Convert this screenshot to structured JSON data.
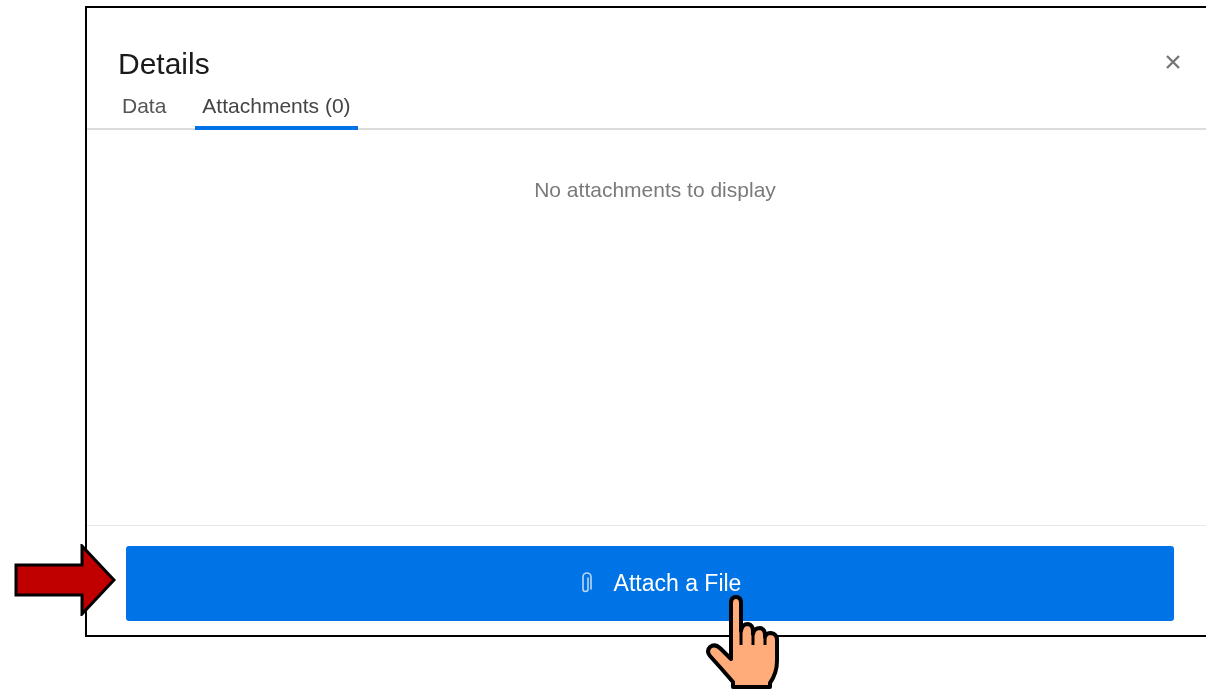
{
  "dialog": {
    "title": "Details",
    "tabs": [
      {
        "label": "Data",
        "selected": false
      },
      {
        "label": "Attachments (0)",
        "selected": true
      }
    ],
    "empty_message": "No attachments to display",
    "attach_button": {
      "label": "Attach a File"
    }
  }
}
